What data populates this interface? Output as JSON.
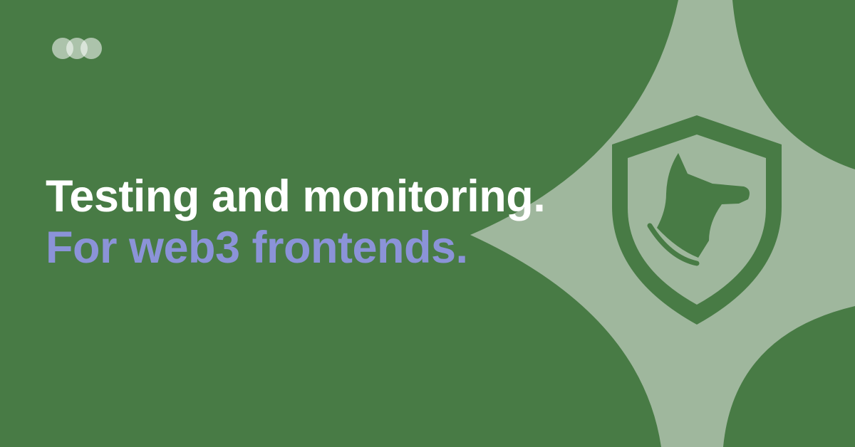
{
  "headline": {
    "line1": "Testing and monitoring.",
    "line2": "For web3 frontends."
  },
  "colors": {
    "background": "#487b45",
    "star": "#9fb79d",
    "line1": "#ffffff",
    "line2": "#8b93d8",
    "logo": "#c6d6c4"
  },
  "icons": {
    "logo": "three-overlapping-circles-logo",
    "badge": "shield-dog-icon"
  }
}
